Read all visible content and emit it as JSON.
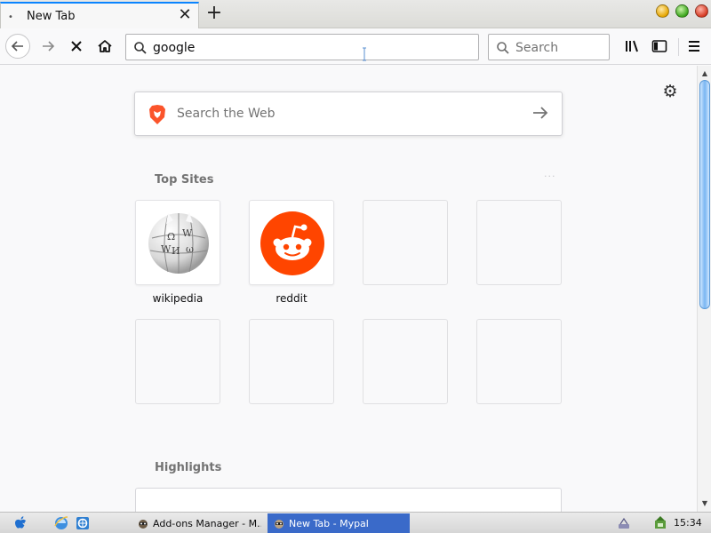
{
  "tab": {
    "title": "New Tab",
    "dot": "•",
    "close": "✕",
    "new_tab": "+"
  },
  "window_buttons": [
    "minimize-button",
    "maximize-button",
    "close-window-button"
  ],
  "navbar": {
    "url_value": "google",
    "search_placeholder": "Search"
  },
  "newtab_page": {
    "web_search_placeholder": "Search the Web",
    "top_sites_title": "Top Sites",
    "top_sites_more": "···",
    "top_sites": [
      {
        "label": "wikipedia",
        "icon": "wikipedia-icon"
      },
      {
        "label": "reddit",
        "icon": "reddit-icon"
      },
      {
        "label": "",
        "icon": ""
      },
      {
        "label": "",
        "icon": ""
      },
      {
        "label": "",
        "icon": ""
      },
      {
        "label": "",
        "icon": ""
      },
      {
        "label": "",
        "icon": ""
      },
      {
        "label": "",
        "icon": ""
      }
    ],
    "highlights_title": "Highlights"
  },
  "taskbar": {
    "tasks": [
      {
        "label": "Add-ons Manager - M...",
        "active": false
      },
      {
        "label": "New Tab - Mypal",
        "active": true
      }
    ],
    "clock": "15:34"
  },
  "colors": {
    "accent": "#0a84ff",
    "reddit": "#ff4500",
    "brave": "#fb542b",
    "taskbar_active": "#3a6ac9"
  }
}
